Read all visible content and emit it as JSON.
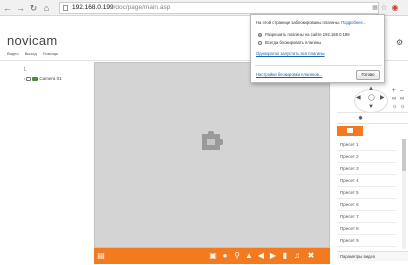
{
  "browser": {
    "url_host": "192.168.0.199",
    "url_path": "/doc/page/main.asp"
  },
  "app": {
    "brand": "novicam",
    "menu": [
      "Видео",
      "Выход",
      "Помощь"
    ]
  },
  "device_tree": {
    "root": "└",
    "camera_label": "Camera 01"
  },
  "presets": {
    "items": [
      "Пресет 1",
      "Пресет 2",
      "Пресет 3",
      "Пресет 4",
      "Пресет 5",
      "Пресет 6",
      "Пресет 7",
      "Пресет 8",
      "Пресет 9"
    ],
    "footer": "Параметры видео"
  },
  "plugin_popup": {
    "prompt": "На этой странице заблокированы плагины.",
    "prompt_link": "Подробнее...",
    "option_allow": "Разрешить плагины на сайте 192.168.0.199",
    "option_block": "Всегда блокировать плагины",
    "run_once_link": "Однократно запустить все плагины",
    "manage_link": "Настройки блокировки плагинов...",
    "done_label": "Готово"
  },
  "colors": {
    "accent": "#f47a20",
    "video_bg": "#d4d4d4"
  }
}
